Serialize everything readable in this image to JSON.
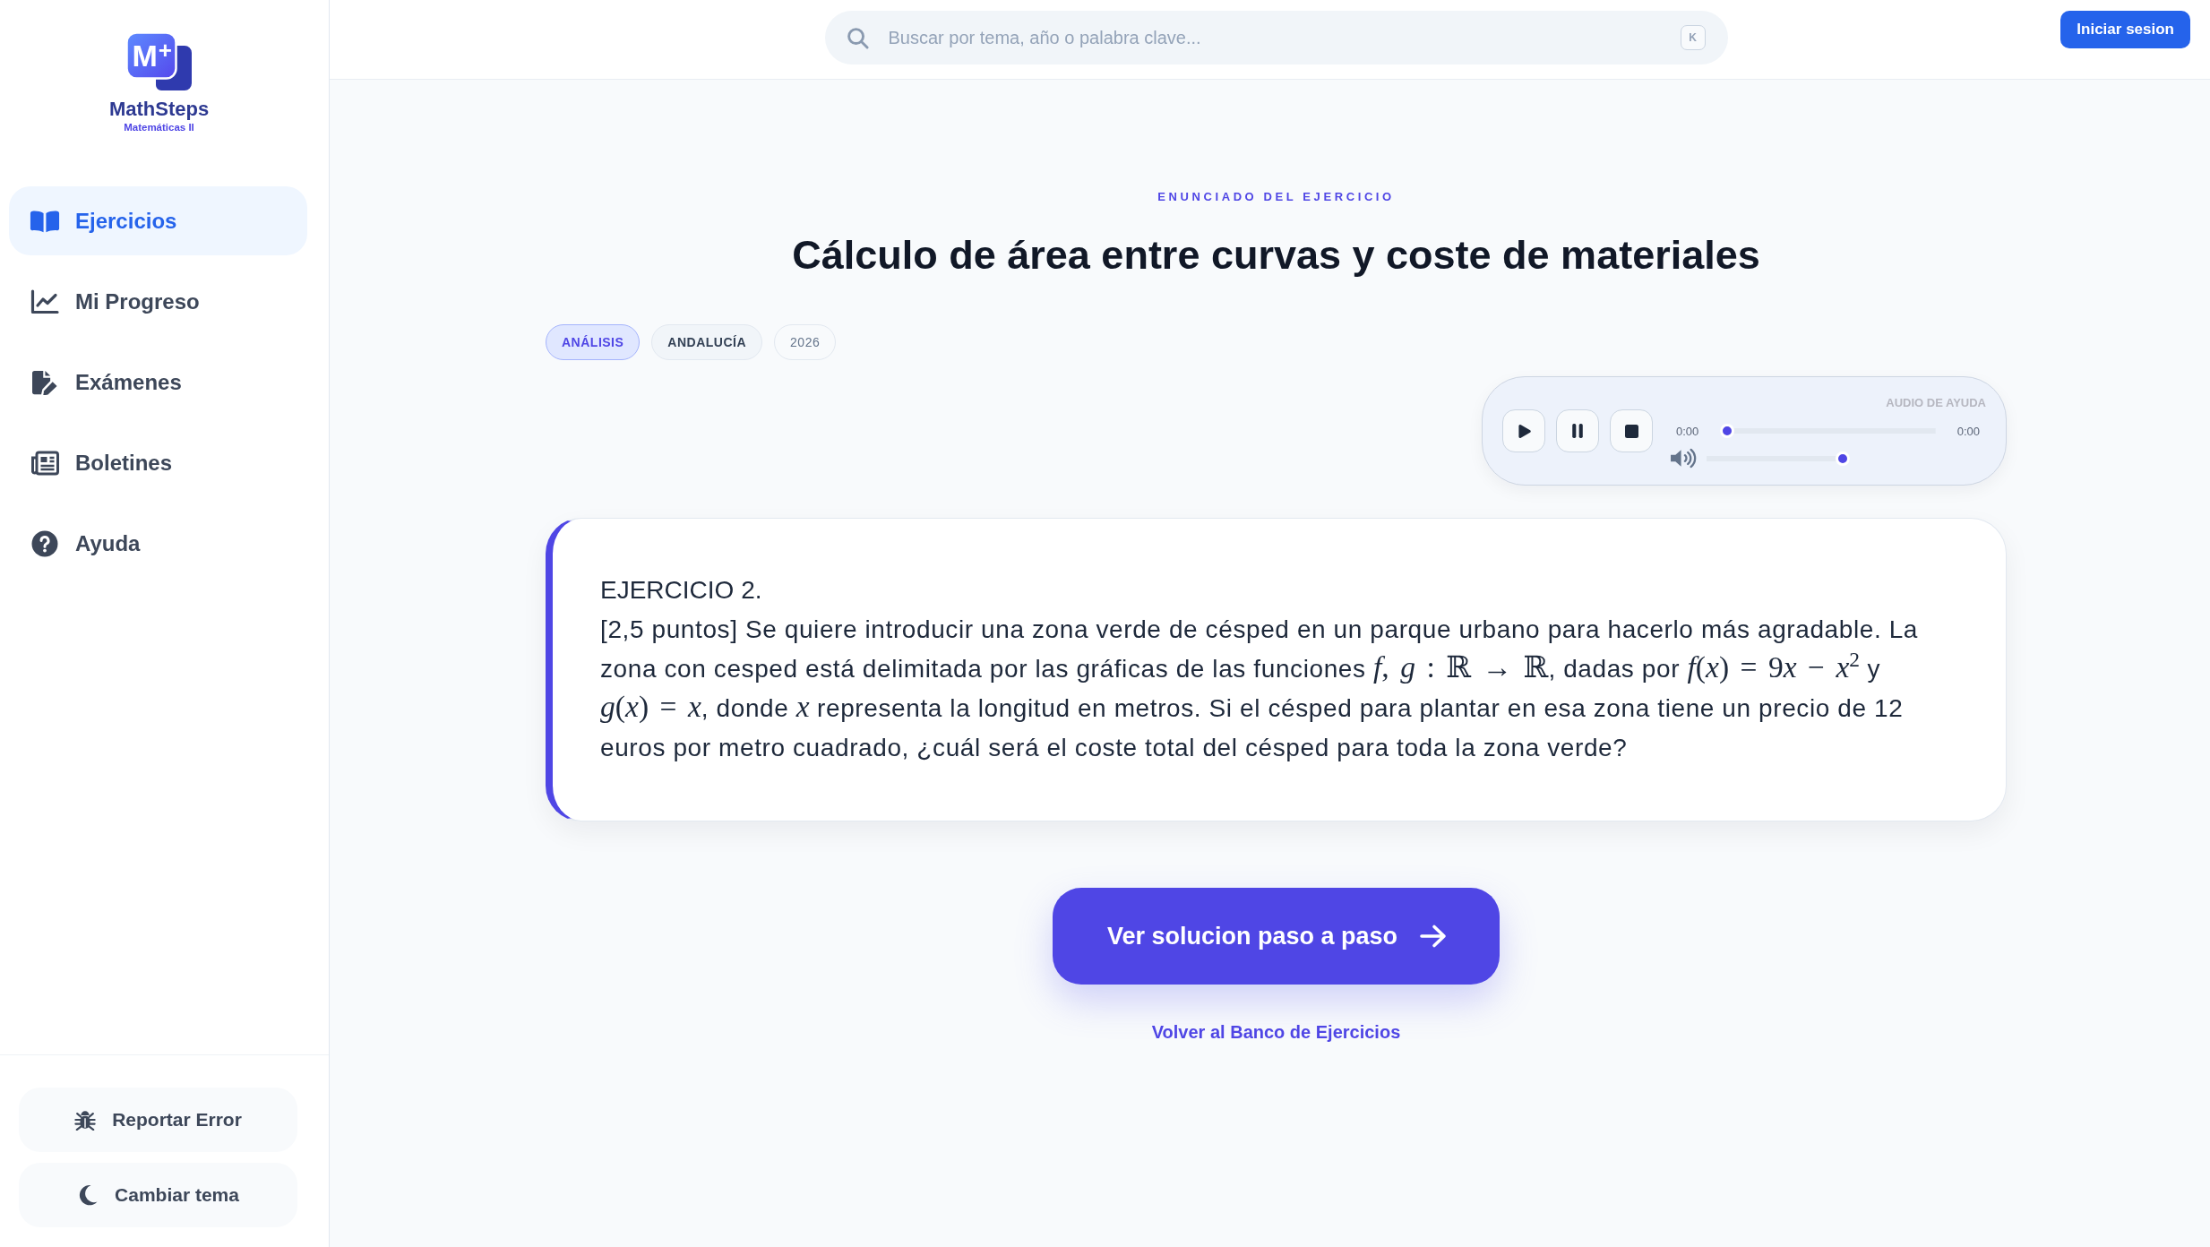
{
  "sidebar": {
    "logo": {
      "mark": "M$^{+}$",
      "name": "MathSteps",
      "subtitle": "Matemáticas II"
    },
    "nav": [
      {
        "label": "Ejercicios",
        "selected": true
      },
      {
        "label": "Mi Progreso",
        "selected": false
      },
      {
        "label": "Exámenes",
        "selected": false
      },
      {
        "label": "Boletines",
        "selected": false
      },
      {
        "label": "Ayuda",
        "selected": false
      }
    ],
    "actions": [
      "Reportar Error",
      "Cambiar tema"
    ]
  },
  "topbar": {
    "search": {
      "placeholder": "Buscar por tema, año o palabra clave...",
      "shortcut": "K"
    },
    "login_button": "Iniciar sesion"
  },
  "exercise": {
    "eyebrow": "ENUNCIADO DEL EJERCICIO",
    "title": "Cálculo de área entre curvas y coste de materiales",
    "tags": [
      {
        "label": "ANÁLISIS",
        "kind": "topic"
      },
      {
        "label": "ANDALUCÍA",
        "kind": "region"
      },
      {
        "label": "2026",
        "kind": "year"
      }
    ],
    "audio": {
      "label": "AUDIO DE AYUDA",
      "current_time": "0:00",
      "duration": "0:00",
      "progress": {
        "level": 0
      },
      "volume": {
        "level": 1
      }
    },
    "card": {
      "heading": "EJERCICIO 2.",
      "statement": [
        {
          "kind": "text",
          "text": "[2,5 puntos] Se quiere introducir una zona verde de césped en un parque urbano para hacerlo más agradable. La zona con cesped está delimitada por las gráficas de las funciones "
        },
        {
          "kind": "math",
          "text": "*f*, *g* : ℝ → ℝ"
        },
        {
          "kind": "text",
          "text": ", dadas por "
        },
        {
          "kind": "math",
          "text": "*f*(*x*) = 9"
        },
        {
          "kind": "math",
          "text": "*x* − *x*$^{2}$"
        },
        {
          "kind": "text",
          "text": " y "
        },
        {
          "kind": "math",
          "text": "*g*(*x*) = *x*"
        },
        {
          "kind": "text",
          "text": ", donde "
        },
        {
          "kind": "math",
          "text": "*x*"
        },
        {
          "kind": "text",
          "text": " representa la longitud en metros. Si el césped para plantar en esa zona tiene un precio de 12 euros por metro cuadrado, ¿cuál será el coste total del césped para toda la zona verde?"
        }
      ]
    },
    "solution_button": "Ver solucion paso a paso",
    "back_link": "Volver al Banco de Ejercicios"
  }
}
